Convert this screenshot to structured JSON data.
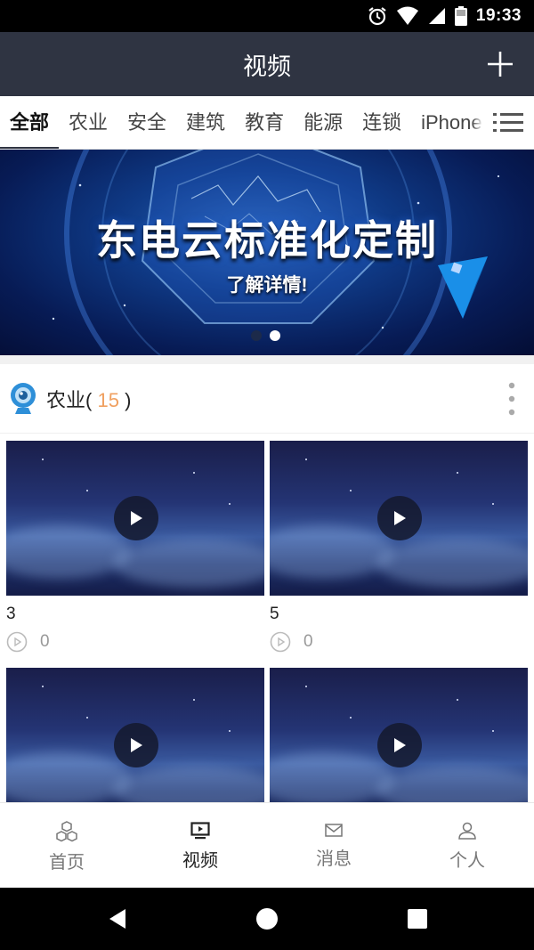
{
  "status_bar": {
    "time": "19:33"
  },
  "header": {
    "title": "视频",
    "add_icon": "plus-icon"
  },
  "tabs": {
    "items": [
      "全部",
      "农业",
      "安全",
      "建筑",
      "教育",
      "能源",
      "连锁",
      "iPhone"
    ],
    "active": "全部",
    "more_icon": "list-menu-icon"
  },
  "banner": {
    "headline": "东电云标准化定制",
    "subline": "了解详情!",
    "slide_count": 2,
    "current_slide": 2
  },
  "section": {
    "title": "农业",
    "count": "15",
    "icon": "webcam-icon"
  },
  "videos": [
    {
      "name": "3",
      "views": "0"
    },
    {
      "name": "5",
      "views": "0"
    },
    {
      "name": "",
      "views": ""
    },
    {
      "name": "",
      "views": ""
    }
  ],
  "bottom_nav": [
    {
      "label": "首页",
      "icon": "cubes-icon"
    },
    {
      "label": "视频",
      "icon": "video-screen-icon",
      "active": true
    },
    {
      "label": "消息",
      "icon": "mail-icon"
    },
    {
      "label": "个人",
      "icon": "person-icon"
    }
  ],
  "colors": {
    "header_bg": "#2f3442",
    "count_accent": "#f0a060",
    "banner_blue": "#0f3a86"
  }
}
